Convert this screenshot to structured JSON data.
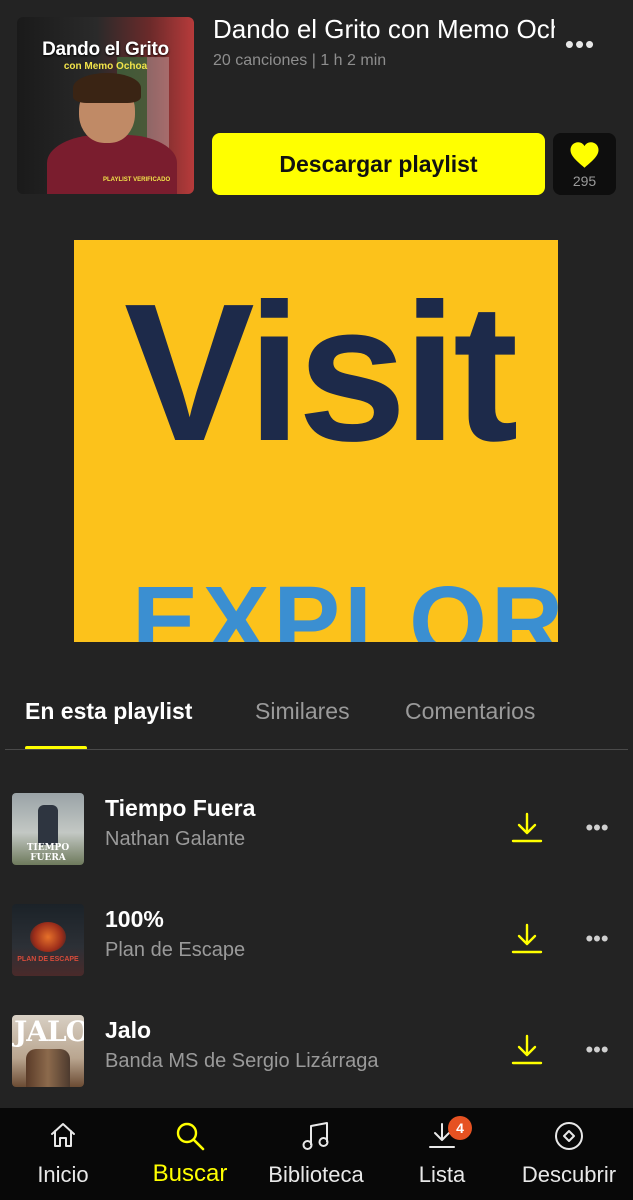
{
  "playlist": {
    "title": "Dando el Grito con Memo Ochoa",
    "meta": "20 canciones |  1 h  2 min",
    "cover_title": "Dando el Grito",
    "cover_subtitle": "con Memo Ochoa",
    "cover_badge": "PLAYLIST VERIFICADO",
    "download_label": "Descargar playlist",
    "likes": "295"
  },
  "ad": {
    "main_text": "Visit",
    "sub_text": "EXPLORA"
  },
  "tabs": [
    {
      "label": "En esta playlist",
      "active": true
    },
    {
      "label": "Similares",
      "active": false
    },
    {
      "label": "Comentarios",
      "active": false
    }
  ],
  "tracks": [
    {
      "name": "Tiempo Fuera",
      "artist": "Nathan Galante",
      "cover_text": "TIEMPO FUERA"
    },
    {
      "name": "100%",
      "artist": "Plan de Escape",
      "cover_text": "PLAN DE ESCAPE"
    },
    {
      "name": "Jalo",
      "artist": "Banda MS de Sergio Lizárraga",
      "cover_text": "JALO"
    }
  ],
  "bottom_nav": {
    "items": [
      {
        "label": "Inicio",
        "icon": "home-icon"
      },
      {
        "label": "Buscar",
        "icon": "search-icon",
        "active": true
      },
      {
        "label": "Biblioteca",
        "icon": "music-note-icon"
      },
      {
        "label": "Lista",
        "icon": "download-list-icon",
        "badge": "4"
      },
      {
        "label": "Descubrir",
        "icon": "compass-icon"
      }
    ]
  },
  "colors": {
    "accent": "#ffff00",
    "background": "#232323",
    "nav_background": "#080808",
    "badge": "#e65222"
  }
}
